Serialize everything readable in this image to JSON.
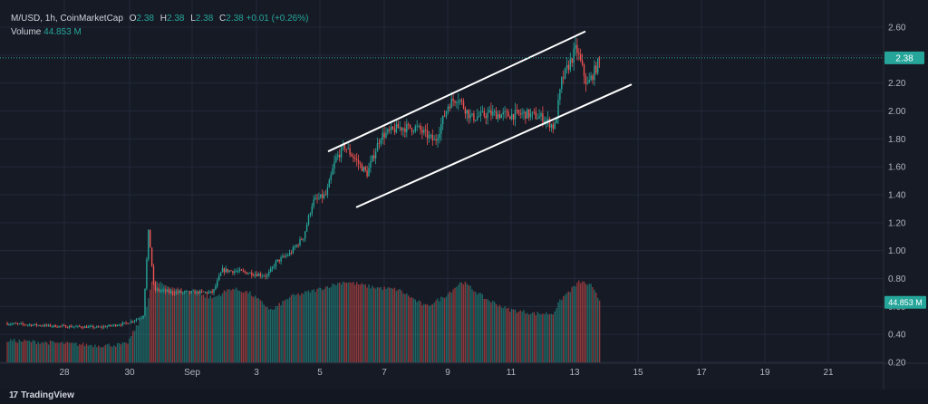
{
  "legend": {
    "symbol": "M/USD, 1h, CoinMarketCap",
    "o_label": "O",
    "o_value": "2.38",
    "h_label": "H",
    "h_value": "2.38",
    "l_label": "L",
    "l_value": "2.38",
    "c_label": "C",
    "c_value": "2.38",
    "change": "+0.01 (+0.26%)",
    "volume_label": "Volume",
    "volume_value": "44.853 M"
  },
  "footer": {
    "brand": "TradingView"
  },
  "colors": {
    "background": "#161a25",
    "up": "#26a69a",
    "down": "#ef5350",
    "grid": "#23283a",
    "axis_text": "#b2b5be",
    "price_tag": "#26a69a",
    "trendline": "#ffffff"
  },
  "chart_data": {
    "type": "candlestick",
    "symbol": "M/USD",
    "interval": "1h",
    "y_ticks": [
      "2.60",
      "2.40",
      "2.20",
      "2.00",
      "1.80",
      "1.60",
      "1.40",
      "1.20",
      "1.00",
      "0.80",
      "0.60",
      "0.40",
      "0.20"
    ],
    "ylim": [
      0.2,
      2.6
    ],
    "x_ticks": [
      "28",
      "30",
      "Sep",
      "3",
      "5",
      "7",
      "9",
      "11",
      "13",
      "15",
      "17",
      "19",
      "21"
    ],
    "last_price": "2.38",
    "last_volume": "44.853 M",
    "price_path": [
      [
        0,
        0.48
      ],
      [
        60,
        0.46
      ],
      [
        110,
        0.45
      ],
      [
        140,
        0.48
      ],
      [
        158,
        0.53
      ],
      [
        164,
        1.15
      ],
      [
        170,
        0.72
      ],
      [
        190,
        0.7
      ],
      [
        225,
        0.7
      ],
      [
        235,
        0.7
      ],
      [
        245,
        0.86
      ],
      [
        265,
        0.85
      ],
      [
        285,
        0.83
      ],
      [
        295,
        0.82
      ],
      [
        305,
        0.92
      ],
      [
        320,
        0.98
      ],
      [
        335,
        1.1
      ],
      [
        345,
        1.35
      ],
      [
        360,
        1.4
      ],
      [
        370,
        1.65
      ],
      [
        380,
        1.75
      ],
      [
        395,
        1.63
      ],
      [
        405,
        1.55
      ],
      [
        420,
        1.82
      ],
      [
        440,
        1.88
      ],
      [
        460,
        1.88
      ],
      [
        480,
        1.78
      ],
      [
        495,
        2.05
      ],
      [
        505,
        2.1
      ],
      [
        520,
        1.95
      ],
      [
        540,
        1.98
      ],
      [
        560,
        1.97
      ],
      [
        580,
        1.98
      ],
      [
        600,
        1.95
      ],
      [
        612,
        1.88
      ],
      [
        620,
        2.22
      ],
      [
        636,
        2.45
      ],
      [
        648,
        2.18
      ],
      [
        663,
        2.38
      ]
    ],
    "volume_path": [
      [
        0,
        0.36
      ],
      [
        60,
        0.34
      ],
      [
        110,
        0.32
      ],
      [
        140,
        0.33
      ],
      [
        150,
        0.45
      ],
      [
        160,
        0.55
      ],
      [
        168,
        0.78
      ],
      [
        200,
        0.72
      ],
      [
        235,
        0.66
      ],
      [
        255,
        0.73
      ],
      [
        275,
        0.7
      ],
      [
        300,
        0.57
      ],
      [
        320,
        0.67
      ],
      [
        350,
        0.72
      ],
      [
        380,
        0.78
      ],
      [
        410,
        0.74
      ],
      [
        440,
        0.72
      ],
      [
        470,
        0.6
      ],
      [
        490,
        0.67
      ],
      [
        510,
        0.78
      ],
      [
        535,
        0.66
      ],
      [
        560,
        0.58
      ],
      [
        590,
        0.55
      ],
      [
        610,
        0.55
      ],
      [
        620,
        0.66
      ],
      [
        640,
        0.78
      ],
      [
        652,
        0.75
      ],
      [
        663,
        0.63
      ]
    ],
    "trendlines": [
      {
        "x1": 362,
        "y1": 1.71,
        "x2": 646,
        "y2": 2.57
      },
      {
        "x1": 393,
        "y1": 1.31,
        "x2": 697,
        "y2": 2.19
      }
    ]
  }
}
